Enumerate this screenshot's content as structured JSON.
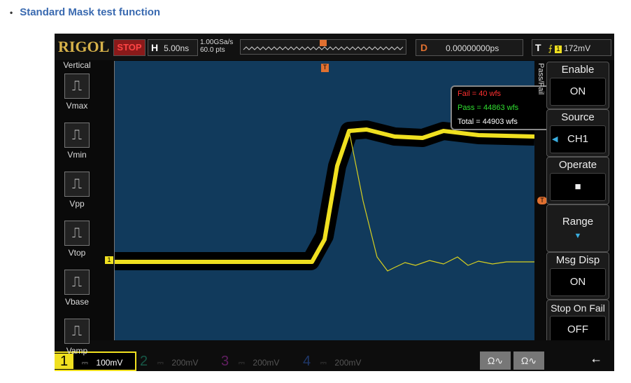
{
  "heading": "Standard Mask test function",
  "top": {
    "logo": "RIGOL",
    "run_state": "STOP",
    "h_label": "H",
    "timebase": "5.00ns",
    "sample_rate": "1.00GSa/s",
    "points": "60.0 pts",
    "d_label": "D",
    "delay": "0.00000000ps",
    "t_label": "T",
    "trigger_source": "1",
    "trigger_level": "172mV"
  },
  "left_menu": {
    "title": "Vertical",
    "items": [
      "Vmax",
      "Vmin",
      "Vpp",
      "Vtop",
      "Vbase",
      "Vamp"
    ]
  },
  "pass_fail": {
    "fail": "Fail  =  40 wfs",
    "pass": "Pass = 44863 wfs",
    "total": "Total = 44903 wfs",
    "tab": "Pass/Fail",
    "colors": {
      "fail": "#ff3030",
      "pass": "#30e030",
      "total": "#ffffff"
    }
  },
  "right_menu": [
    {
      "title": "Enable",
      "value": "ON"
    },
    {
      "title": "Source",
      "value": "CH1"
    },
    {
      "title": "Operate",
      "value": "■"
    },
    {
      "title": "Range",
      "value": "▼"
    },
    {
      "title": "Msg Disp",
      "value": "ON"
    },
    {
      "title": "Stop On Fail",
      "value": "OFF"
    }
  ],
  "channels": [
    {
      "num": "1",
      "scale": "100mV",
      "color": "#f0e020"
    },
    {
      "num": "2",
      "scale": "200mV",
      "color": "#20a080"
    },
    {
      "num": "3",
      "scale": "200mV",
      "color": "#b030b0"
    },
    {
      "num": "4",
      "scale": "200mV",
      "color": "#3060c0"
    }
  ],
  "markers": {
    "trigger": "T",
    "ch1": "1"
  }
}
